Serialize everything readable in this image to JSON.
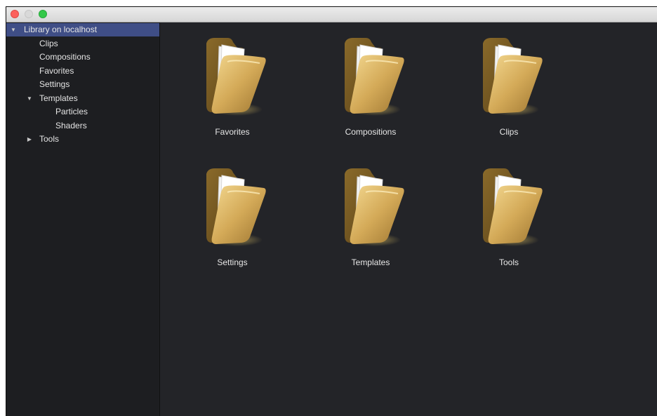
{
  "window": {
    "buttons": [
      "close",
      "minimize",
      "zoom"
    ]
  },
  "sidebar": {
    "root": {
      "label": "Library on localhost",
      "expanded": true,
      "selected": true
    },
    "items": [
      {
        "label": "Clips"
      },
      {
        "label": "Compositions"
      },
      {
        "label": "Favorites"
      },
      {
        "label": "Settings"
      },
      {
        "label": "Templates",
        "expanded": true,
        "children": [
          {
            "label": "Particles"
          },
          {
            "label": "Shaders"
          }
        ]
      },
      {
        "label": "Tools",
        "expanded": false
      }
    ]
  },
  "content": {
    "folders": [
      {
        "label": "Favorites",
        "icon": "folder-icon"
      },
      {
        "label": "Compositions",
        "icon": "folder-icon"
      },
      {
        "label": "Clips",
        "icon": "folder-icon"
      },
      {
        "label": "Settings",
        "icon": "folder-icon"
      },
      {
        "label": "Templates",
        "icon": "folder-icon"
      },
      {
        "label": "Tools",
        "icon": "folder-icon"
      }
    ]
  },
  "colors": {
    "background": "#232428",
    "sidebar": "#1d1e21",
    "selection": "#3f4e86",
    "folder": "#c9a24e"
  }
}
